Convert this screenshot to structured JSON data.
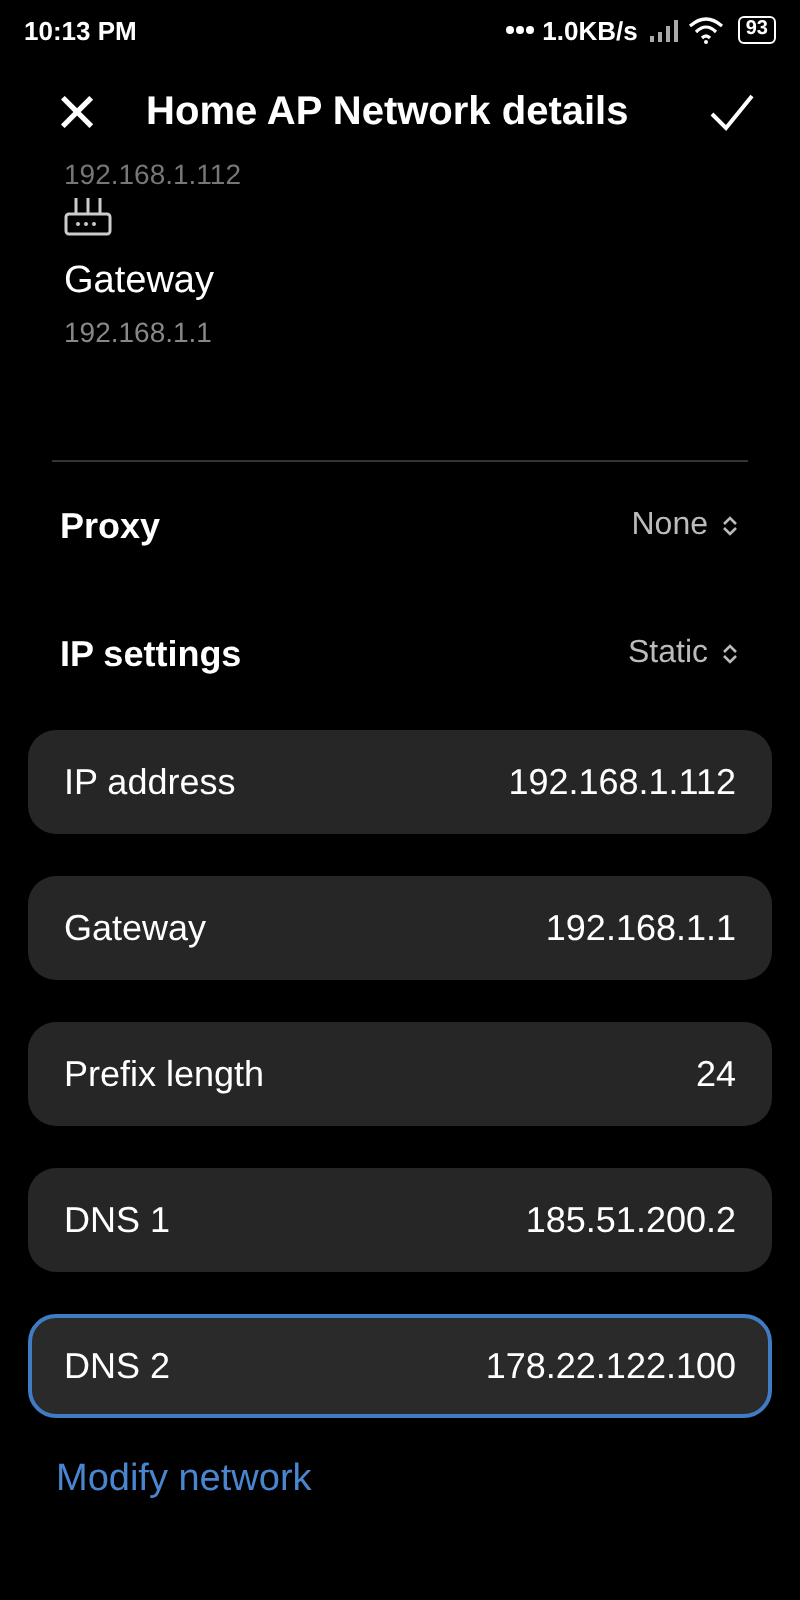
{
  "status_bar": {
    "time": "10:13 PM",
    "speed": "1.0KB/s",
    "battery": "93"
  },
  "header": {
    "close": "×",
    "title": "Home AP Network details"
  },
  "info": {
    "ip_value": "192.168.1.112",
    "gateway_label": "Gateway",
    "gateway_value": "192.168.1.1"
  },
  "selectors": [
    {
      "label": "Proxy",
      "value": "None"
    },
    {
      "label": "IP settings",
      "value": "Static"
    }
  ],
  "fields": [
    {
      "label": "IP address",
      "value": "192.168.1.112",
      "selected": false
    },
    {
      "label": "Gateway",
      "value": "192.168.1.1",
      "selected": false
    },
    {
      "label": "Prefix length",
      "value": "24",
      "selected": false
    },
    {
      "label": "DNS 1",
      "value": "185.51.200.2",
      "selected": false
    },
    {
      "label": "DNS 2",
      "value": "178.22.122.100",
      "selected": true
    }
  ],
  "link": "Modify network"
}
